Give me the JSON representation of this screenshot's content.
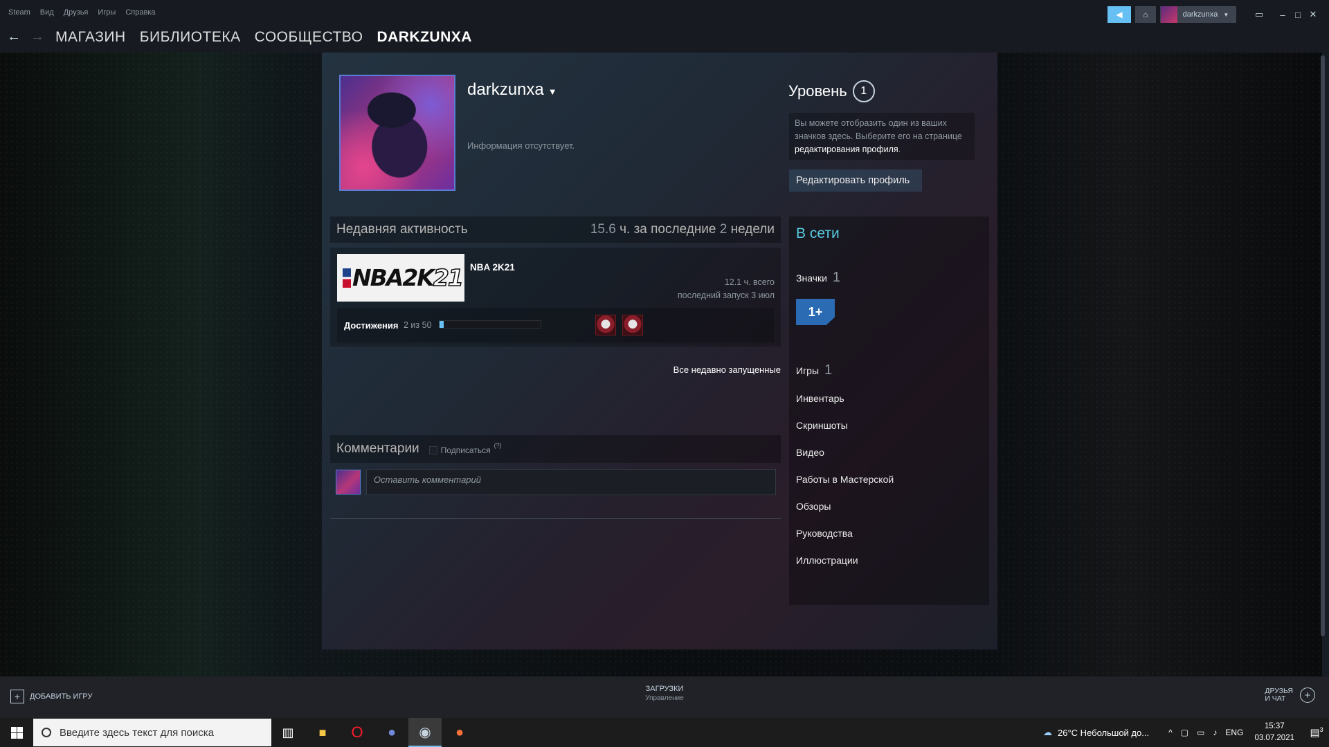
{
  "menubar": {
    "items": [
      "Steam",
      "Вид",
      "Друзья",
      "Игры",
      "Справка"
    ]
  },
  "account": {
    "name": "darkzunxa"
  },
  "nav": {
    "tabs": [
      "МАГАЗИН",
      "БИБЛИОТЕКА",
      "СООБЩЕСТВО",
      "DARKZUNXA"
    ]
  },
  "profile": {
    "username": "darkzunxa",
    "summary": "Информация отсутствует.",
    "level_label": "Уровень",
    "level": "1",
    "badge_hint_text": "Вы можете отобразить один из ваших значков здесь. Выберите его на странице ",
    "badge_hint_link": "редактирования профиля",
    "badge_hint_end": ".",
    "edit_button": "Редактировать профиль"
  },
  "recent": {
    "title": "Недавняя активность",
    "hours_value": "15.6",
    "hours_mid": " ч. за последние ",
    "weeks_value": "2",
    "weeks_label": " недели",
    "game": {
      "logo_nba": "NBA",
      "logo_2k": "2K",
      "logo_21": "21",
      "name": "NBA 2K21",
      "total": "12.1 ч. всего",
      "last_played": "последний запуск 3 июл",
      "achievements_label": "Достижения",
      "achievements_count": "2 из 50",
      "achievements_progress": 0.04
    },
    "all_link": "Все недавно запущенные"
  },
  "comments": {
    "title": "Комментарии",
    "subscribe": "Подписаться",
    "help": "(?)",
    "placeholder": "Оставить комментарий"
  },
  "sidebar": {
    "status": "В сети",
    "badges_label": "Значки",
    "badges_count": "1",
    "badge_text": "1+",
    "games_label": "Игры",
    "games_count": "1",
    "links": [
      "Инвентарь",
      "Скриншоты",
      "Видео",
      "Работы в Мастерской",
      "Обзоры",
      "Руководства",
      "Иллюстрации"
    ]
  },
  "bottom": {
    "add_game": "ДОБАВИТЬ ИГРУ",
    "downloads": "ЗАГРУЗКИ",
    "downloads_sub": "Управление",
    "friends_line1": "ДРУЗЬЯ",
    "friends_line2": "И ЧАТ"
  },
  "taskbar": {
    "search_placeholder": "Введите здесь текст для поиска",
    "weather": "26°C  Небольшой до...",
    "lang": "ENG",
    "time": "15:37",
    "date": "03.07.2021",
    "notif_count": "3"
  },
  "colors": {
    "accent": "#66c0f4",
    "online": "#57cbde",
    "badge": "#2a6bb3"
  }
}
